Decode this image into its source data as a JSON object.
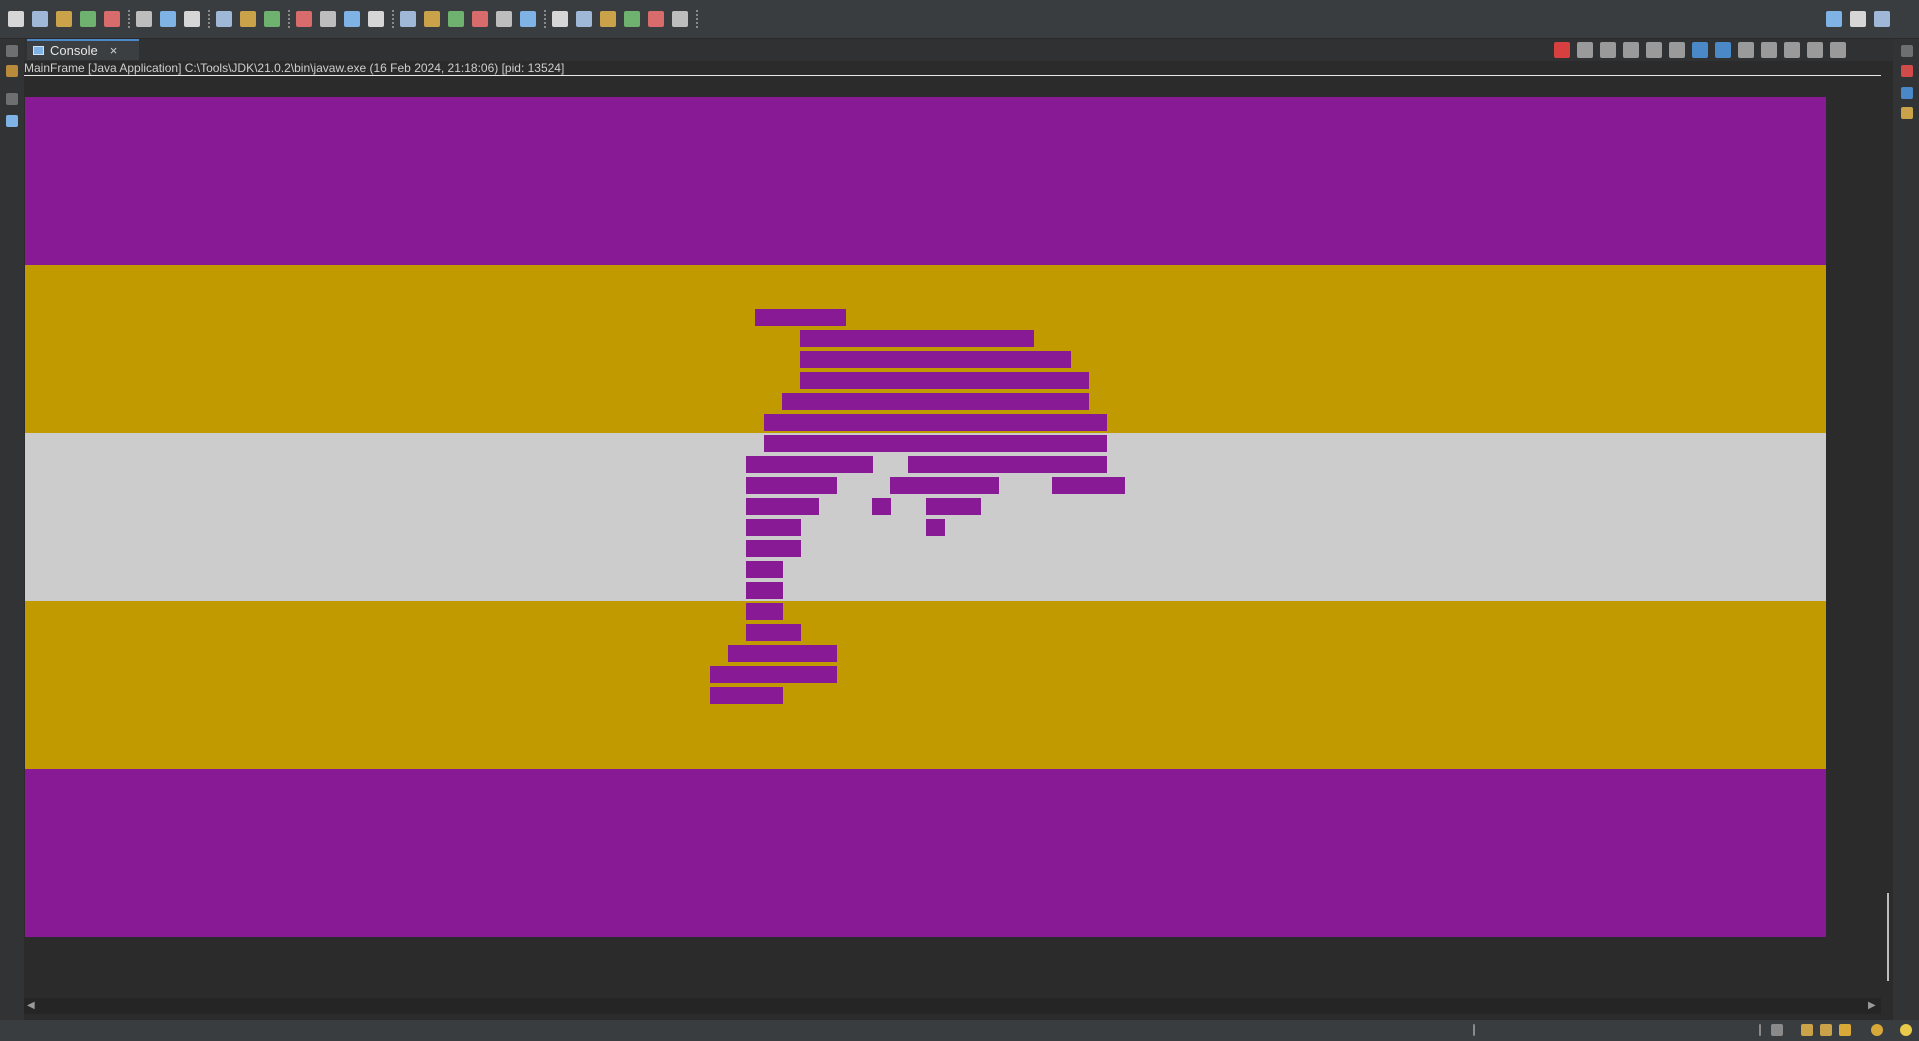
{
  "window": {
    "view_tab": "Console",
    "close_glyph": "×",
    "process_label": "MainFrame [Java Application] C:\\Tools\\JDK\\21.0.2\\bin\\javaw.exe  (16 Feb 2024, 21:18:06) [pid: 13524]"
  },
  "toolbar_icons": [
    "new-icon",
    "save-icon",
    "save-all-icon",
    "undo-icon",
    "redo-icon",
    "terminal-icon",
    "skip-breakpoints-icon",
    "debug-icon",
    "run-icon",
    "coverage-icon",
    "external-tools-icon",
    "new-java-project-icon",
    "new-class-icon",
    "open-type-icon",
    "open-resource-icon",
    "search-icon",
    "annotation-icon",
    "edit-icon",
    "mark-icon",
    "toggle-icon",
    "whitespace-icon",
    "next-annotation-icon",
    "prev-annotation-icon",
    "last-edit-icon",
    "back-icon",
    "forward-icon",
    "pin-icon",
    "quick-access-search-icon",
    "open-perspective-icon",
    "java-perspective-icon"
  ],
  "console_actions": [
    "terminate-icon",
    "remove-launch-icon",
    "remove-all-terminated-icon",
    "scroll-lock-icon",
    "word-wrap-icon",
    "clear-console-icon",
    "show-stdout-icon",
    "show-stderr-icon",
    "pin-console-icon",
    "display-console-icon",
    "open-console-icon",
    "minimize-icon",
    "maximize-icon"
  ],
  "app_window": {
    "flag_colors": {
      "purple": "#891a96",
      "gold": "#c19a00",
      "grey": "#cccccc"
    },
    "stripe_order": [
      "purple",
      "gold",
      "grey",
      "gold",
      "purple"
    ]
  },
  "colors": {
    "ide_background": "#2b2b2b",
    "toolbar": "#3a3d3f",
    "tab_accent": "#4a88c7"
  }
}
